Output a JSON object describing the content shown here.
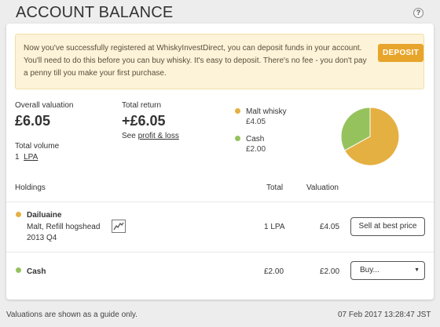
{
  "header": {
    "title": "ACCOUNT BALANCE",
    "help_icon": "?"
  },
  "notice": {
    "text": "Now you've successfully registered at WhiskyInvestDirect, you can deposit funds in your account. You'll need to do this before you can buy whisky. It's easy to deposit. There's no fee - you don't pay a penny till you make your first purchase.",
    "deposit_label": "DEPOSIT"
  },
  "summary": {
    "valuation_label": "Overall valuation",
    "valuation_value": "£6.05",
    "return_label": "Total return",
    "return_value": "+£6.05",
    "see_prefix": "See",
    "profit_link": "profit & loss",
    "volume_label": "Total volume",
    "volume_qty": "1",
    "volume_unit": "LPA"
  },
  "allocation": [
    {
      "name": "Malt whisky",
      "value": "£4.05",
      "amount": 4.05,
      "color": "#e5b042"
    },
    {
      "name": "Cash",
      "value": "£2.00",
      "amount": 2.0,
      "color": "#96c25d"
    }
  ],
  "holdings": {
    "columns": {
      "holdings": "Holdings",
      "total": "Total",
      "valuation": "Valuation"
    },
    "rows": [
      {
        "name": "Dailuaine",
        "detail": "Malt, Refill hogshead",
        "period": "2013 Q4",
        "total": "1 LPA",
        "valuation": "£4.05",
        "action": "Sell at best price",
        "chart_icon": "price-chart-icon"
      },
      {
        "name": "Cash",
        "total": "£2.00",
        "valuation": "£2.00",
        "action": "Buy..."
      }
    ]
  },
  "footer": {
    "note": "Valuations are shown as a guide only.",
    "timestamp": "07 Feb 2017 13:28:47 JST"
  }
}
